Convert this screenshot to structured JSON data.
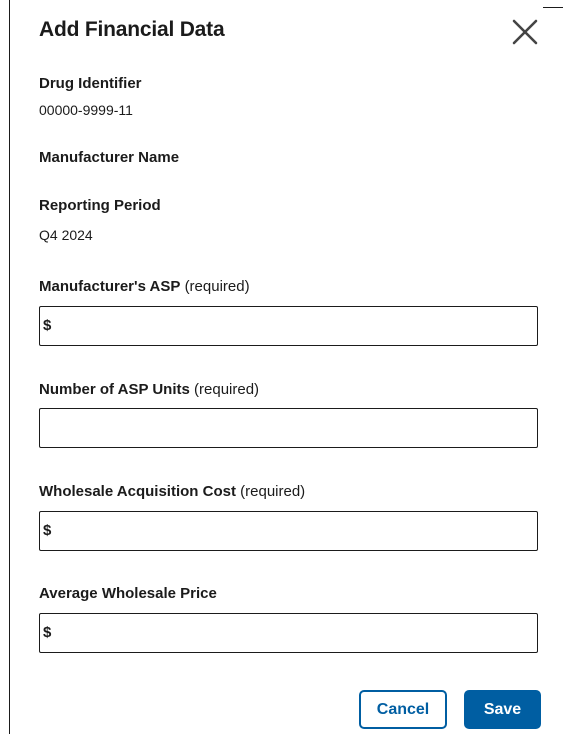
{
  "modal": {
    "title": "Add Financial Data",
    "close_icon": "close-icon"
  },
  "fields": {
    "drug_identifier": {
      "label": "Drug Identifier",
      "value": "00000-9999-11"
    },
    "manufacturer_name": {
      "label": "Manufacturer Name",
      "value": ""
    },
    "reporting_period": {
      "label": "Reporting Period",
      "value": "Q4 2024"
    }
  },
  "inputs": {
    "manufacturer_asp": {
      "label": "Manufacturer's ASP",
      "required_text": "(required)",
      "prefix": "$",
      "value": ""
    },
    "asp_units": {
      "label": "Number of ASP Units",
      "required_text": "(required)",
      "value": ""
    },
    "wholesale_acquisition_cost": {
      "label": "Wholesale Acquisition Cost",
      "required_text": "(required)",
      "prefix": "$",
      "value": ""
    },
    "average_wholesale_price": {
      "label": "Average Wholesale Price",
      "prefix": "$",
      "value": ""
    }
  },
  "actions": {
    "cancel_label": "Cancel",
    "save_label": "Save"
  },
  "colors": {
    "primary": "#005ea2",
    "text": "#1b1b1b",
    "background": "#ffffff"
  }
}
